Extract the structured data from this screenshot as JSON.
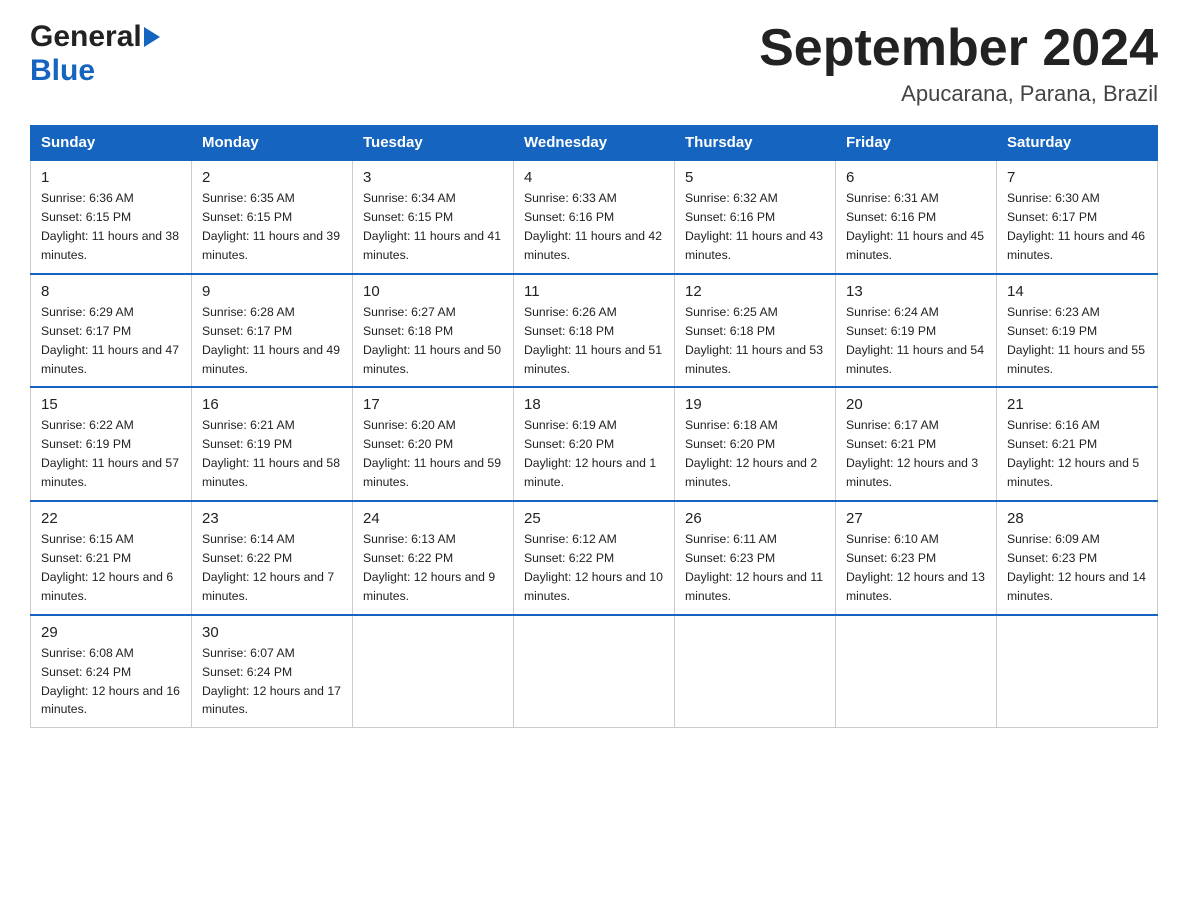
{
  "logo": {
    "general": "General",
    "blue": "Blue",
    "arrow_color": "#1565c0"
  },
  "title": "September 2024",
  "subtitle": "Apucarana, Parana, Brazil",
  "days_of_week": [
    "Sunday",
    "Monday",
    "Tuesday",
    "Wednesday",
    "Thursday",
    "Friday",
    "Saturday"
  ],
  "weeks": [
    [
      {
        "day": "1",
        "sunrise": "Sunrise: 6:36 AM",
        "sunset": "Sunset: 6:15 PM",
        "daylight": "Daylight: 11 hours and 38 minutes."
      },
      {
        "day": "2",
        "sunrise": "Sunrise: 6:35 AM",
        "sunset": "Sunset: 6:15 PM",
        "daylight": "Daylight: 11 hours and 39 minutes."
      },
      {
        "day": "3",
        "sunrise": "Sunrise: 6:34 AM",
        "sunset": "Sunset: 6:15 PM",
        "daylight": "Daylight: 11 hours and 41 minutes."
      },
      {
        "day": "4",
        "sunrise": "Sunrise: 6:33 AM",
        "sunset": "Sunset: 6:16 PM",
        "daylight": "Daylight: 11 hours and 42 minutes."
      },
      {
        "day": "5",
        "sunrise": "Sunrise: 6:32 AM",
        "sunset": "Sunset: 6:16 PM",
        "daylight": "Daylight: 11 hours and 43 minutes."
      },
      {
        "day": "6",
        "sunrise": "Sunrise: 6:31 AM",
        "sunset": "Sunset: 6:16 PM",
        "daylight": "Daylight: 11 hours and 45 minutes."
      },
      {
        "day": "7",
        "sunrise": "Sunrise: 6:30 AM",
        "sunset": "Sunset: 6:17 PM",
        "daylight": "Daylight: 11 hours and 46 minutes."
      }
    ],
    [
      {
        "day": "8",
        "sunrise": "Sunrise: 6:29 AM",
        "sunset": "Sunset: 6:17 PM",
        "daylight": "Daylight: 11 hours and 47 minutes."
      },
      {
        "day": "9",
        "sunrise": "Sunrise: 6:28 AM",
        "sunset": "Sunset: 6:17 PM",
        "daylight": "Daylight: 11 hours and 49 minutes."
      },
      {
        "day": "10",
        "sunrise": "Sunrise: 6:27 AM",
        "sunset": "Sunset: 6:18 PM",
        "daylight": "Daylight: 11 hours and 50 minutes."
      },
      {
        "day": "11",
        "sunrise": "Sunrise: 6:26 AM",
        "sunset": "Sunset: 6:18 PM",
        "daylight": "Daylight: 11 hours and 51 minutes."
      },
      {
        "day": "12",
        "sunrise": "Sunrise: 6:25 AM",
        "sunset": "Sunset: 6:18 PM",
        "daylight": "Daylight: 11 hours and 53 minutes."
      },
      {
        "day": "13",
        "sunrise": "Sunrise: 6:24 AM",
        "sunset": "Sunset: 6:19 PM",
        "daylight": "Daylight: 11 hours and 54 minutes."
      },
      {
        "day": "14",
        "sunrise": "Sunrise: 6:23 AM",
        "sunset": "Sunset: 6:19 PM",
        "daylight": "Daylight: 11 hours and 55 minutes."
      }
    ],
    [
      {
        "day": "15",
        "sunrise": "Sunrise: 6:22 AM",
        "sunset": "Sunset: 6:19 PM",
        "daylight": "Daylight: 11 hours and 57 minutes."
      },
      {
        "day": "16",
        "sunrise": "Sunrise: 6:21 AM",
        "sunset": "Sunset: 6:19 PM",
        "daylight": "Daylight: 11 hours and 58 minutes."
      },
      {
        "day": "17",
        "sunrise": "Sunrise: 6:20 AM",
        "sunset": "Sunset: 6:20 PM",
        "daylight": "Daylight: 11 hours and 59 minutes."
      },
      {
        "day": "18",
        "sunrise": "Sunrise: 6:19 AM",
        "sunset": "Sunset: 6:20 PM",
        "daylight": "Daylight: 12 hours and 1 minute."
      },
      {
        "day": "19",
        "sunrise": "Sunrise: 6:18 AM",
        "sunset": "Sunset: 6:20 PM",
        "daylight": "Daylight: 12 hours and 2 minutes."
      },
      {
        "day": "20",
        "sunrise": "Sunrise: 6:17 AM",
        "sunset": "Sunset: 6:21 PM",
        "daylight": "Daylight: 12 hours and 3 minutes."
      },
      {
        "day": "21",
        "sunrise": "Sunrise: 6:16 AM",
        "sunset": "Sunset: 6:21 PM",
        "daylight": "Daylight: 12 hours and 5 minutes."
      }
    ],
    [
      {
        "day": "22",
        "sunrise": "Sunrise: 6:15 AM",
        "sunset": "Sunset: 6:21 PM",
        "daylight": "Daylight: 12 hours and 6 minutes."
      },
      {
        "day": "23",
        "sunrise": "Sunrise: 6:14 AM",
        "sunset": "Sunset: 6:22 PM",
        "daylight": "Daylight: 12 hours and 7 minutes."
      },
      {
        "day": "24",
        "sunrise": "Sunrise: 6:13 AM",
        "sunset": "Sunset: 6:22 PM",
        "daylight": "Daylight: 12 hours and 9 minutes."
      },
      {
        "day": "25",
        "sunrise": "Sunrise: 6:12 AM",
        "sunset": "Sunset: 6:22 PM",
        "daylight": "Daylight: 12 hours and 10 minutes."
      },
      {
        "day": "26",
        "sunrise": "Sunrise: 6:11 AM",
        "sunset": "Sunset: 6:23 PM",
        "daylight": "Daylight: 12 hours and 11 minutes."
      },
      {
        "day": "27",
        "sunrise": "Sunrise: 6:10 AM",
        "sunset": "Sunset: 6:23 PM",
        "daylight": "Daylight: 12 hours and 13 minutes."
      },
      {
        "day": "28",
        "sunrise": "Sunrise: 6:09 AM",
        "sunset": "Sunset: 6:23 PM",
        "daylight": "Daylight: 12 hours and 14 minutes."
      }
    ],
    [
      {
        "day": "29",
        "sunrise": "Sunrise: 6:08 AM",
        "sunset": "Sunset: 6:24 PM",
        "daylight": "Daylight: 12 hours and 16 minutes."
      },
      {
        "day": "30",
        "sunrise": "Sunrise: 6:07 AM",
        "sunset": "Sunset: 6:24 PM",
        "daylight": "Daylight: 12 hours and 17 minutes."
      },
      null,
      null,
      null,
      null,
      null
    ]
  ]
}
